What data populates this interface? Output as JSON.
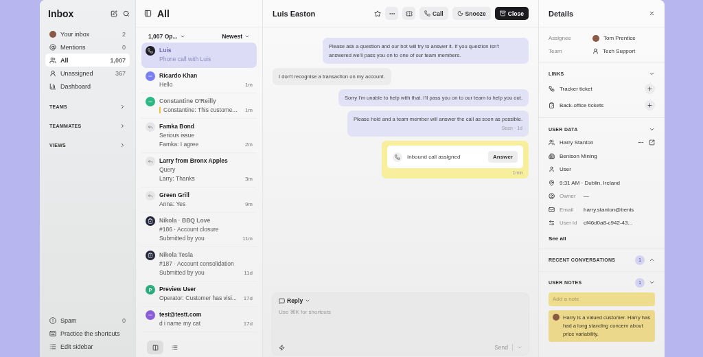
{
  "sidebar": {
    "title": "Inbox",
    "nav": [
      {
        "label": "Your inbox",
        "count": "2",
        "selected": false
      },
      {
        "label": "Mentions",
        "count": "0",
        "selected": false
      },
      {
        "label": "All",
        "count": "1,007",
        "selected": true
      },
      {
        "label": "Unassigned",
        "count": "367",
        "selected": false
      },
      {
        "label": "Dashboard",
        "selected": false
      }
    ],
    "groups": [
      "TEAMS",
      "TEAMMATES",
      "VIEWS"
    ],
    "footer": [
      {
        "label": "Spam",
        "count": "0"
      },
      {
        "label": "Practice the shortcuts"
      },
      {
        "label": "Edit sidebar"
      }
    ]
  },
  "conversations": {
    "title": "All",
    "filter": "1,007 Op...",
    "sort": "Newest",
    "items": [
      {
        "kind": "phone",
        "name": "Luis",
        "lines": [
          "Phone call with Luis"
        ],
        "unread": true,
        "selected": true
      },
      {
        "kind": "dot",
        "color": "#7b80f0",
        "name": "Ricardo Khan",
        "lines": [
          "Hello"
        ],
        "time": "1m",
        "unread": true,
        "selected": false
      },
      {
        "kind": "dot",
        "color": "#2cb784",
        "name": "Constantine O'Reilly",
        "lines": [
          "Constantine: This custome..."
        ],
        "time": "1m",
        "note": true,
        "unread": false,
        "selected": false
      },
      {
        "kind": "reply",
        "name": "Famka Bond",
        "lines": [
          "Serious issue",
          "Famka: I agree"
        ],
        "time": "2m",
        "unread": true,
        "selected": false
      },
      {
        "kind": "reply",
        "name": "Larry from Bronx Apples",
        "lines": [
          "Query",
          "Larry: Thanks"
        ],
        "time": "3m",
        "unread": true,
        "selected": false
      },
      {
        "kind": "reply",
        "name": "Green Grill",
        "lines": [
          "Anna: Yes"
        ],
        "time": "9m",
        "unread": true,
        "selected": false
      },
      {
        "kind": "ticket",
        "name": "Nikola · BBQ Love",
        "lines": [
          "#186 · Account closure",
          "Submitted by you"
        ],
        "time": "11m",
        "unread": false,
        "selected": false
      },
      {
        "kind": "ticket",
        "name": "Nikola Tesla",
        "lines": [
          "#187 · Account consolidation",
          "Submitted by you"
        ],
        "time": "11d",
        "unread": false,
        "selected": false
      },
      {
        "kind": "letter",
        "color": "#2cab7d",
        "initial": "P",
        "name": "Preview User",
        "lines": [
          "Operator: Customer has visi..."
        ],
        "time": "17d",
        "unread": true,
        "selected": false
      },
      {
        "kind": "dot",
        "color": "#8a5cd6",
        "name": "test@testt.com",
        "lines": [
          "d i name my cat"
        ],
        "time": "17d",
        "unread": true,
        "selected": false
      }
    ],
    "view_toggle": [
      {
        "selected": true
      },
      {
        "selected": false
      }
    ]
  },
  "chat": {
    "title": "Luis Easton",
    "actions": [
      {
        "kind": "secondary",
        "label": "Call"
      },
      {
        "kind": "secondary",
        "label": "Snooze"
      },
      {
        "kind": "primary",
        "label": "Close"
      }
    ],
    "messages": [
      {
        "kind": "bot",
        "text": "Please ask a question and our bot will try to answer it. If you question isn't answered we'll pass you on to one of our team members."
      },
      {
        "kind": "customer",
        "text": "I don't recognise a transaction on my account."
      },
      {
        "kind": "bot",
        "text": "Sorry I'm unable to help with that. I'll pass you on to our team to help you out."
      },
      {
        "kind": "bot",
        "text": "Please hold and a team member will answer the call as soon as possible.",
        "meta": "Seen · 1d"
      },
      {
        "kind": "call",
        "text": "Inbound call assigned",
        "button": "Answer",
        "meta": "1min"
      }
    ],
    "composer": {
      "mode": "Reply",
      "placeholder": "Use ⌘K for shortcuts",
      "send": "Send"
    }
  },
  "details": {
    "title": "Details",
    "fields": [
      {
        "label": "Assignee",
        "value": "Tom Prentice"
      },
      {
        "label": "Team",
        "value": "Tech Support"
      }
    ],
    "links": {
      "title": "LINKS",
      "expanded": true,
      "items": [
        "Tracker ticket",
        "Back-office tickets"
      ]
    },
    "user_data": {
      "title": "USER DATA",
      "expanded": true,
      "rows": [
        {
          "value": "Harry Stanton"
        },
        {
          "value": "Benison Mining"
        },
        {
          "value": "User"
        },
        {
          "value": "9:31 AM · Dublin, Ireland"
        },
        {
          "label": "Owner",
          "value": "—"
        },
        {
          "label": "Email",
          "value": "harry.stanton@benis"
        },
        {
          "label": "User id",
          "value": "cf46d0a8-c942-43..."
        }
      ],
      "see_all": "See all"
    },
    "recent": {
      "title": "RECENT CONVERSATIONS",
      "count": "1",
      "expanded": false
    },
    "notes": {
      "title": "USER NOTES",
      "count": "1",
      "expanded": true,
      "placeholder": "Add a note",
      "items": [
        "Harry is a valued customer. Harry has had a long standing concern about price variability."
      ]
    }
  }
}
